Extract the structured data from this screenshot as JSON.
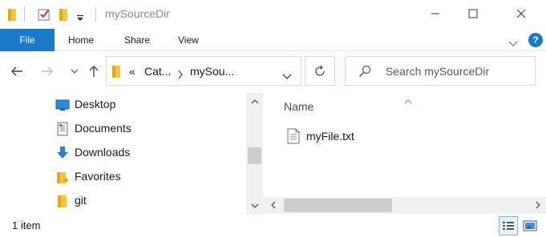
{
  "window": {
    "title": "mySourceDir",
    "controls": {
      "minimize": "—",
      "maximize": "☐",
      "close": "✕"
    }
  },
  "ribbon": {
    "tabs": [
      {
        "label": "File",
        "active": true
      },
      {
        "label": "Home"
      },
      {
        "label": "Share"
      },
      {
        "label": "View"
      }
    ],
    "help": "?"
  },
  "navigation": {
    "breadcrumb_overflow": "«",
    "breadcrumbs": [
      "Cat...",
      "mySou..."
    ],
    "search_placeholder": "Search mySourceDir"
  },
  "nav_pane": {
    "items": [
      {
        "label": "Desktop",
        "icon": "desktop-icon"
      },
      {
        "label": "Documents",
        "icon": "documents-icon"
      },
      {
        "label": "Downloads",
        "icon": "downloads-icon"
      },
      {
        "label": "Favorites",
        "icon": "favorites-icon"
      },
      {
        "label": "git",
        "icon": "folder-icon"
      }
    ]
  },
  "content": {
    "columns": [
      "Name"
    ],
    "files": [
      {
        "name": "myFile.txt",
        "icon": "text-file-icon"
      }
    ]
  },
  "status": {
    "item_count": "1 item"
  },
  "colors": {
    "accent": "#1979ca",
    "folder": "#f5c444",
    "border": "#d9d9d9"
  }
}
